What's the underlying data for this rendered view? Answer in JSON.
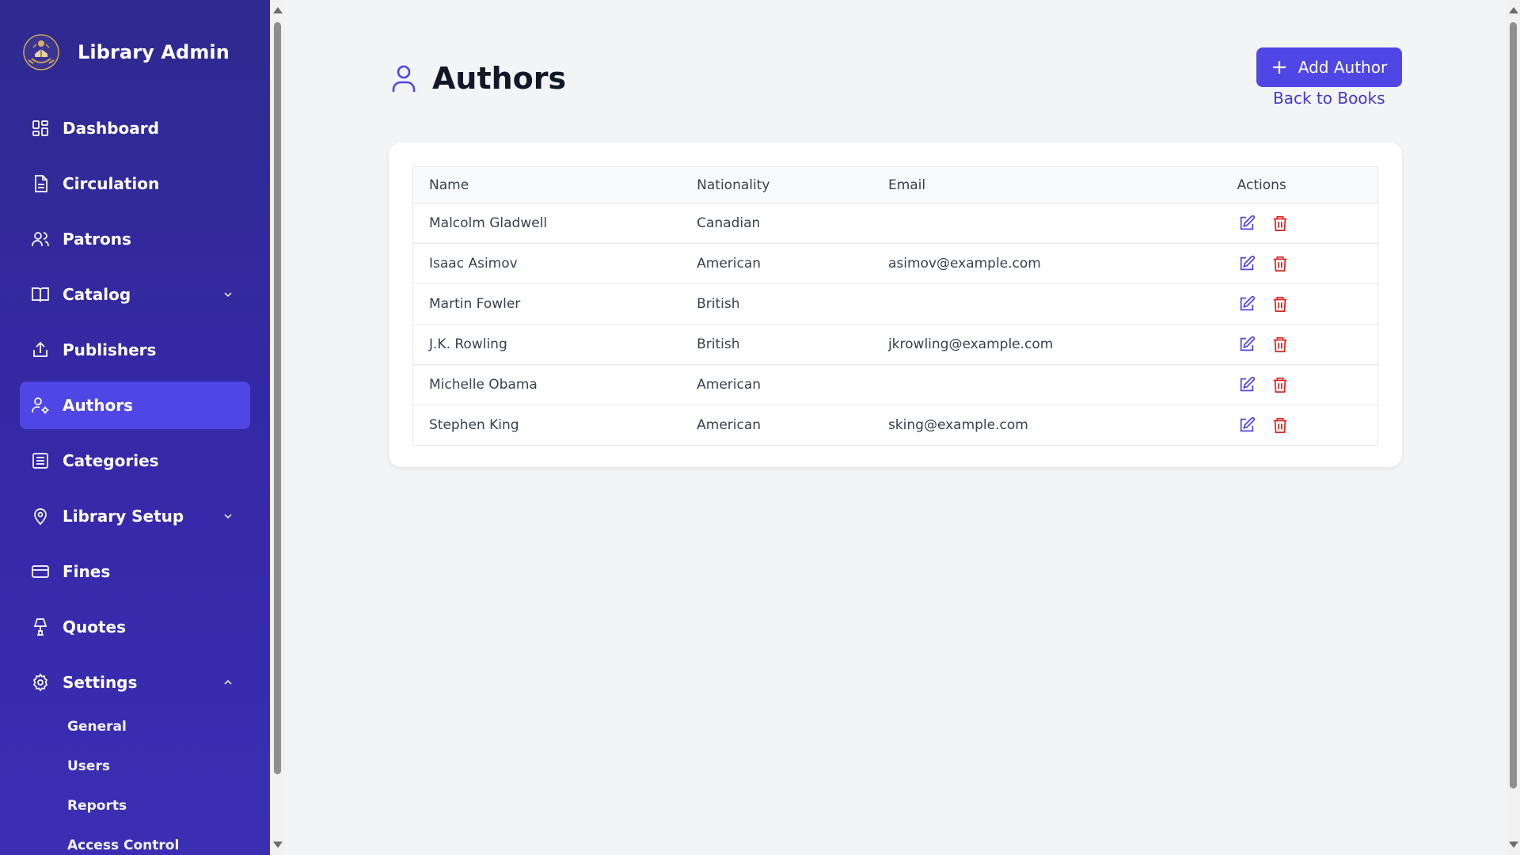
{
  "app": {
    "title": "Library Admin",
    "logo_icon": "library-crest-logo"
  },
  "sidebar": {
    "items": [
      {
        "label": "Dashboard",
        "icon": "dashboard-icon",
        "active": false,
        "chevron": ""
      },
      {
        "label": "Circulation",
        "icon": "document-icon",
        "active": false,
        "chevron": ""
      },
      {
        "label": "Patrons",
        "icon": "users-icon",
        "active": false,
        "chevron": ""
      },
      {
        "label": "Catalog",
        "icon": "book-open-icon",
        "active": false,
        "chevron": "down"
      },
      {
        "label": "Publishers",
        "icon": "upload-icon",
        "active": false,
        "chevron": ""
      },
      {
        "label": "Authors",
        "icon": "user-cog-icon",
        "active": true,
        "chevron": ""
      },
      {
        "label": "Categories",
        "icon": "list-icon",
        "active": false,
        "chevron": ""
      },
      {
        "label": "Library Setup",
        "icon": "map-pin-icon",
        "active": false,
        "chevron": "down"
      },
      {
        "label": "Fines",
        "icon": "credit-card-icon",
        "active": false,
        "chevron": ""
      },
      {
        "label": "Quotes",
        "icon": "lamp-icon",
        "active": false,
        "chevron": ""
      },
      {
        "label": "Settings",
        "icon": "gear-icon",
        "active": false,
        "chevron": "up"
      }
    ],
    "settings_sub": [
      "General",
      "Users",
      "Reports",
      "Access Control"
    ]
  },
  "page": {
    "title": "Authors",
    "add_button": "Add Author",
    "back_link": "Back to Books"
  },
  "table": {
    "headers": [
      "Name",
      "Nationality",
      "Email",
      "Actions"
    ],
    "rows": [
      {
        "name": "Malcolm Gladwell",
        "nationality": "Canadian",
        "email": ""
      },
      {
        "name": "Isaac Asimov",
        "nationality": "American",
        "email": "asimov@example.com"
      },
      {
        "name": "Martin Fowler",
        "nationality": "British",
        "email": ""
      },
      {
        "name": "J.K. Rowling",
        "nationality": "British",
        "email": "jkrowling@example.com"
      },
      {
        "name": "Michelle Obama",
        "nationality": "American",
        "email": ""
      },
      {
        "name": "Stephen King",
        "nationality": "American",
        "email": "sking@example.com"
      }
    ]
  },
  "colors": {
    "sidebar_bg": "#3529a8",
    "accent": "#4f46e5",
    "edit_icon": "#4f46e5",
    "delete_icon": "#dc2626"
  }
}
